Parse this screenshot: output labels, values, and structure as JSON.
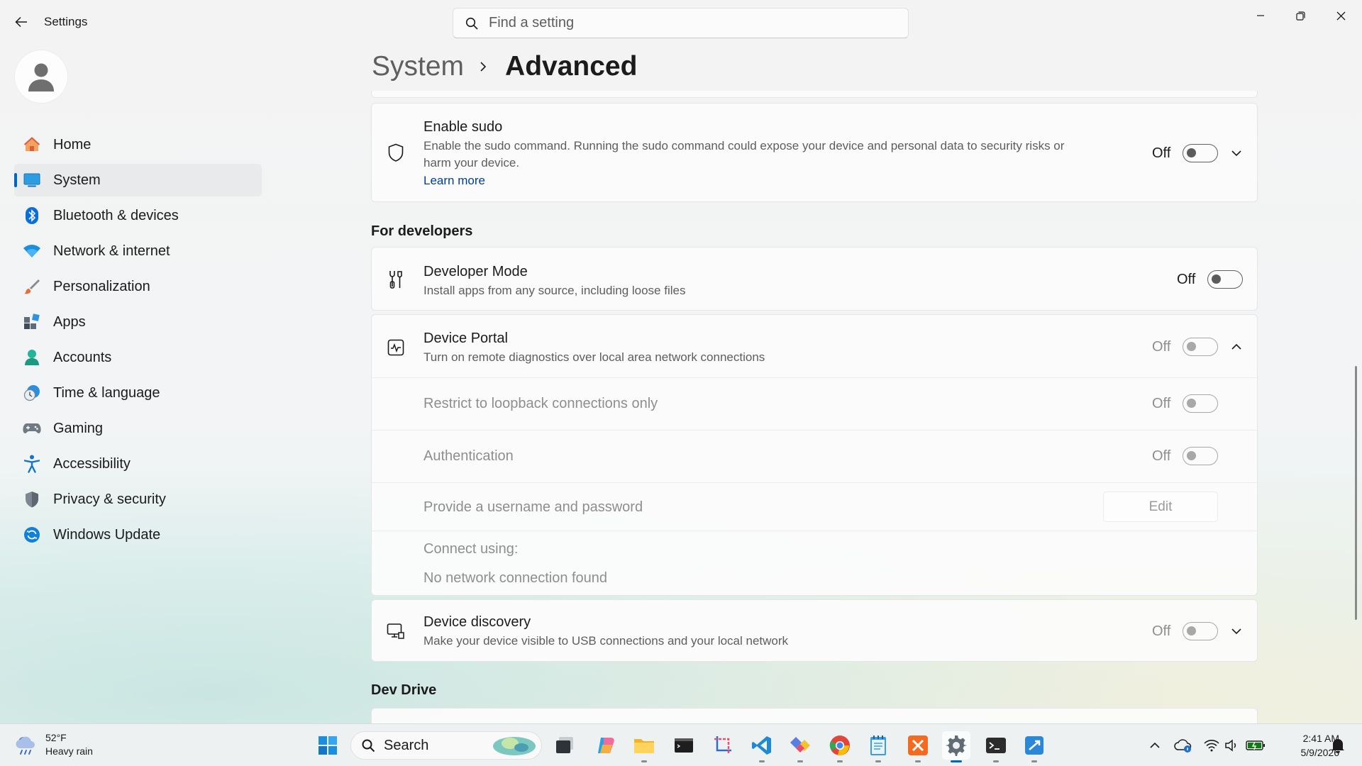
{
  "window": {
    "app_title": "Settings",
    "search_placeholder": "Find a setting"
  },
  "sidebar": {
    "items": [
      {
        "label": "Home",
        "icon": "home-icon"
      },
      {
        "label": "System",
        "icon": "system-icon",
        "selected": true
      },
      {
        "label": "Bluetooth & devices",
        "icon": "bluetooth-icon"
      },
      {
        "label": "Network & internet",
        "icon": "wifi-icon"
      },
      {
        "label": "Personalization",
        "icon": "brush-icon"
      },
      {
        "label": "Apps",
        "icon": "apps-icon"
      },
      {
        "label": "Accounts",
        "icon": "accounts-icon"
      },
      {
        "label": "Time & language",
        "icon": "clock-globe-icon"
      },
      {
        "label": "Gaming",
        "icon": "gamepad-icon"
      },
      {
        "label": "Accessibility",
        "icon": "accessibility-icon"
      },
      {
        "label": "Privacy & security",
        "icon": "shield-icon"
      },
      {
        "label": "Windows Update",
        "icon": "update-icon"
      }
    ]
  },
  "header": {
    "parent": "System",
    "current": "Advanced"
  },
  "sudo": {
    "title": "Enable sudo",
    "desc_line1": "Enable the sudo command. Running the sudo command could expose your device and personal data to security risks or",
    "desc_line2": "harm your device.",
    "link": "Learn more",
    "state": "Off"
  },
  "developers": {
    "section_title": "For developers",
    "developer_mode": {
      "title": "Developer Mode",
      "desc": "Install apps from any source, including loose files",
      "state": "Off"
    },
    "device_portal": {
      "title": "Device Portal",
      "desc": "Turn on remote diagnostics over local area network connections",
      "state": "Off",
      "loopback": {
        "label": "Restrict to loopback connections only",
        "state": "Off"
      },
      "authentication": {
        "label": "Authentication",
        "state": "Off"
      },
      "credentials": {
        "label": "Provide a username and password",
        "button": "Edit"
      },
      "connect_label": "Connect using:",
      "connect_value": "No network connection found"
    },
    "device_discovery": {
      "title": "Device discovery",
      "desc": "Make your device visible to USB connections and your local network",
      "state": "Off"
    }
  },
  "dev_drive": {
    "section_title": "Dev Drive"
  },
  "taskbar": {
    "weather_temp": "52°F",
    "weather_cond": "Heavy rain",
    "search_label": "Search",
    "time": "2:41 AM",
    "date": "5/9/2026"
  },
  "colors": {
    "accent": "#0067c0",
    "link": "#003e92"
  }
}
